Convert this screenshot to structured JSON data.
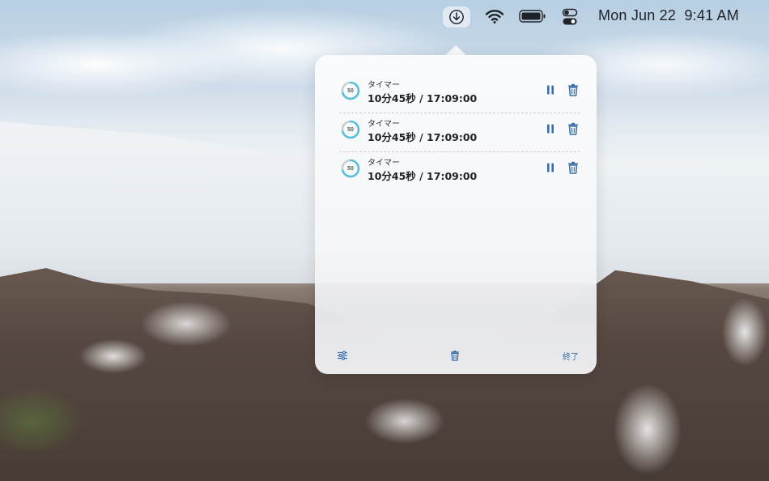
{
  "menubar": {
    "date": "Mon Jun 22",
    "time": "9:41 AM",
    "icons": [
      "download-status-icon",
      "wifi-icon",
      "battery-icon",
      "control-center-icon"
    ]
  },
  "popover": {
    "timers": [
      {
        "ring_value": "50",
        "name": "タイマー",
        "time": "10分45秒 / 17:09:00",
        "progress": 0.7
      },
      {
        "ring_value": "50",
        "name": "タイマー",
        "time": "10分45秒 / 17:09:00",
        "progress": 0.7
      },
      {
        "ring_value": "50",
        "name": "タイマー",
        "time": "10分45秒 / 17:09:00",
        "progress": 0.7
      }
    ],
    "row_icons": [
      "pause-icon",
      "trash-icon"
    ],
    "footer": {
      "settings_icon": "sliders-icon",
      "clear_icon": "trash-icon",
      "quit_label": "終了"
    }
  },
  "colors": {
    "accent": "#3a6ea8",
    "ring_progress": "#5bc0de",
    "ring_track": "#c9ced4"
  }
}
